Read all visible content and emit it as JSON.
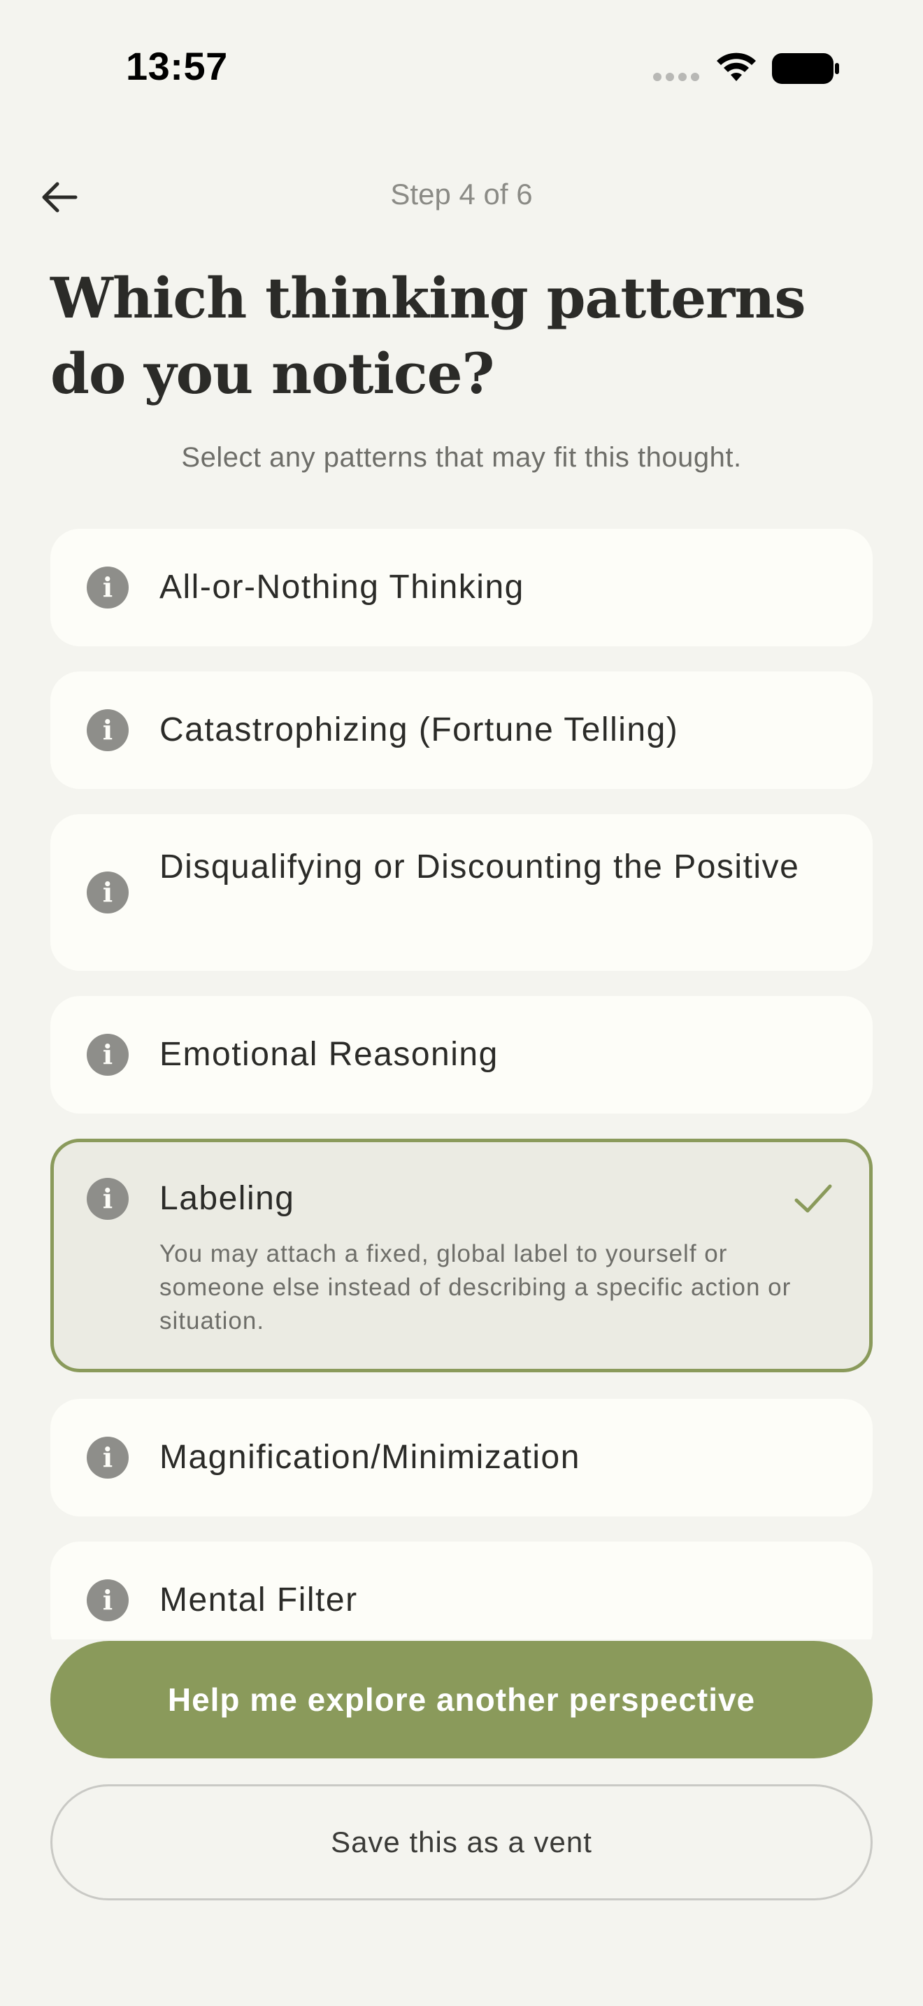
{
  "status_bar": {
    "time": "13:57"
  },
  "header": {
    "back_icon": "arrow-left-icon",
    "step": "Step 4 of 6"
  },
  "title": "Which thinking patterns do you notice?",
  "subtitle": "Select any patterns that may fit this thought.",
  "patterns": [
    {
      "label": "All-or-Nothing Thinking",
      "icon": "info-icon",
      "selected": false
    },
    {
      "label": "Catastrophizing (Fortune Telling)",
      "icon": "info-icon",
      "selected": false
    },
    {
      "label": "Disqualifying or Discounting the Positive",
      "icon": "info-icon",
      "selected": false
    },
    {
      "label": "Emotional Reasoning",
      "icon": "info-icon",
      "selected": false
    },
    {
      "label": "Labeling",
      "icon": "info-icon",
      "selected": true,
      "description": "You may attach a fixed, global label to yourself or someone else instead of describing a specific action or situation."
    },
    {
      "label": "Magnification/Minimization",
      "icon": "info-icon",
      "selected": false
    },
    {
      "label": "Mental Filter",
      "icon": "info-icon",
      "selected": false
    }
  ],
  "actions": {
    "primary": "Help me explore another perspective",
    "secondary": "Save this as a vent"
  },
  "colors": {
    "background": "#f4f4ef",
    "card": "#fdfdf8",
    "accent": "#8a9a5b",
    "selected_card": "#ebebe3",
    "info_icon": "#8e8e8a"
  }
}
